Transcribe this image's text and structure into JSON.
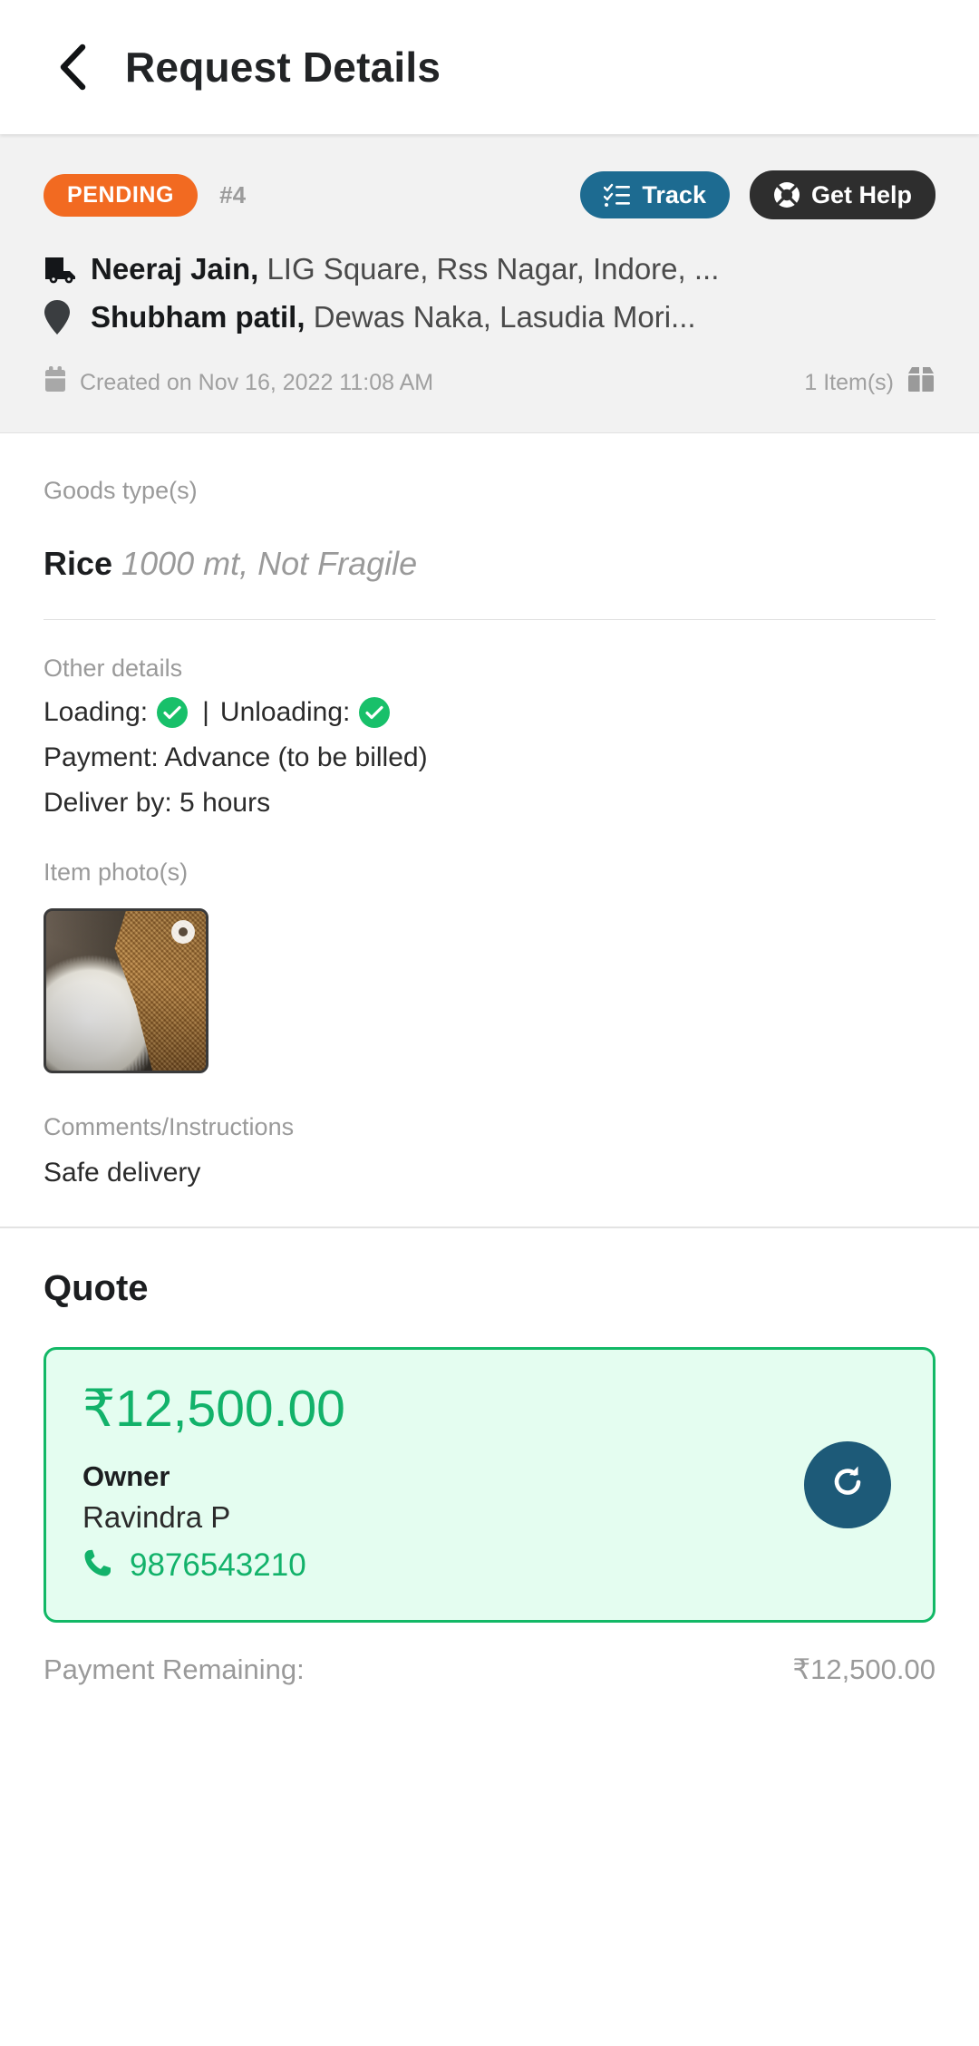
{
  "header": {
    "back_icon": "chevron-left-icon",
    "title": "Request Details"
  },
  "summary": {
    "status": "PENDING",
    "request_id": "#4",
    "track_button": "Track",
    "track_icon": "checklist-icon",
    "help_button": "Get Help",
    "help_icon": "lifebuoy-icon",
    "pickup": {
      "icon": "truck-icon",
      "name": "Neeraj Jain,",
      "address": "LIG Square, Rss Nagar, Indore, ..."
    },
    "drop": {
      "icon": "map-pin-icon",
      "name": "Shubham patil,",
      "address": "Dewas Naka, Lasudia Mori..."
    },
    "created": "Created on Nov 16, 2022 11:08 AM",
    "created_icon": "calendar-icon",
    "items_count": "1 Item(s)",
    "items_icon": "box-icon"
  },
  "goods": {
    "label": "Goods type(s)",
    "name": "Rice",
    "description": "1000 mt, Not Fragile"
  },
  "other_details": {
    "label": "Other details",
    "loading_label": "Loading:",
    "separator": "|",
    "unloading_label": "Unloading:",
    "loading_checked": true,
    "unloading_checked": true,
    "payment": "Payment: Advance (to be billed)",
    "deliver_by": "Deliver by: 5 hours"
  },
  "photos": {
    "label": "Item photo(s)",
    "count": 1,
    "alt": "rice-and-jute-sack-photo"
  },
  "comments": {
    "label": "Comments/Instructions",
    "text": "Safe delivery"
  },
  "quote": {
    "title": "Quote",
    "amount": "₹12,500.00",
    "owner_label": "Owner",
    "owner_name": "Ravindra P",
    "phone": "9876543210",
    "phone_icon": "phone-icon",
    "refresh_icon": "refresh-icon"
  },
  "payment_remaining": {
    "label": "Payment Remaining:",
    "value": "₹12,500.00"
  },
  "colors": {
    "status_orange": "#f26a21",
    "track_blue": "#1d6b91",
    "help_dark": "#2e2e2e",
    "green": "#12b26a",
    "quote_bg": "#e4fdf0",
    "fab_blue": "#1d5a78",
    "panel_gray": "#f2f2f2"
  }
}
